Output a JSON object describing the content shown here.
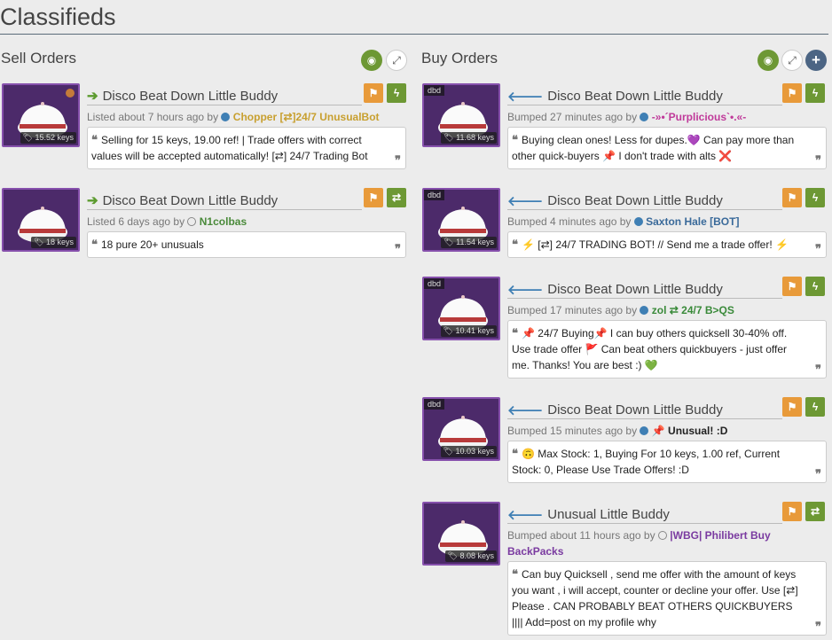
{
  "page_title": "Classifieds",
  "sections": {
    "sell_title": "Sell Orders",
    "buy_title": "Buy Orders"
  },
  "icons": {
    "eye": "◉",
    "expand": "⤢",
    "plus": "+",
    "flag": "⚑",
    "lightning": "ϟ",
    "swap": "⇄",
    "arrow_right": "➔",
    "arrow_left": "🡐",
    "quote_open": "❝",
    "quote_close": "❞",
    "tag": "🏷"
  },
  "sell_listings": [
    {
      "item": "Disco Beat Down Little Buddy",
      "price": "15.52 keys",
      "listed": "Listed about 7 hours ago by",
      "user": "Chopper [⇄]24/7 UnusualBot",
      "user_color": "#c8a030",
      "message": "Selling for 15 keys, 19.00 ref! | Trade offers with correct values will be accepted automatically! [⇄] 24/7 Trading Bot",
      "action": "lightning"
    },
    {
      "item": "Disco Beat Down Little Buddy",
      "price": "18 keys",
      "listed": "Listed 6 days ago by",
      "user": "N1colbas",
      "user_color": "#4a8a3a",
      "message": "18 pure 20+ unusuals",
      "action": "swap"
    }
  ],
  "buy_listings": [
    {
      "item": "Disco Beat Down Little Buddy",
      "price": "11.68 keys",
      "tag": "dbd",
      "listed": "Bumped 27 minutes ago by",
      "user": "-»•´Purplicious`•.«-",
      "user_color": "#c03a9a",
      "message": "Buying clean ones! Less for dupes.💜 Can pay more than other quick-buyers 📌 I don't trade with alts ❌",
      "action": "lightning"
    },
    {
      "item": "Disco Beat Down Little Buddy",
      "price": "11.54 keys",
      "tag": "dbd",
      "listed": "Bumped 4 minutes ago by",
      "user": "Saxton Hale [BOT]",
      "user_color": "#3a6a9a",
      "message": "⚡ [⇄] 24/7 TRADING BOT! // Send me a trade offer! ⚡",
      "action": "lightning"
    },
    {
      "item": "Disco Beat Down Little Buddy",
      "price": "10.41 keys",
      "tag": "dbd",
      "listed": "Bumped 17 minutes ago by",
      "user": "zol ⇄ 24/7 B>QS",
      "user_color": "#3a8a3a",
      "message": "📌 24/7 Buying📌  I can buy others quicksell 30-40% off. Use trade offer 🚩 Can beat others quickbuyers - just offer me. Thanks! You are best :) 💚",
      "action": "lightning"
    },
    {
      "item": "Disco Beat Down Little Buddy",
      "price": "10.03 keys",
      "tag": "dbd",
      "listed": "Bumped 15 minutes ago by",
      "user": "📌 Unusual! :D",
      "user_color": "#222222",
      "message": "🙃 Max Stock: 1, Buying For 10 keys, 1.00 ref, Current Stock: 0, Please Use Trade Offers! :D",
      "action": "lightning"
    },
    {
      "item": "Unusual Little Buddy",
      "price": "8.08 keys",
      "tag": "",
      "listed": "Bumped about 11 hours ago by",
      "user": "|WBG| Philibert Buy BackPacks",
      "user_color": "#7a3aa0",
      "message": "Can buy Quicksell , send me offer with the amount of keys you want , i will accept, counter or decline your offer. Use [⇄] Please . CAN PROBABLY BEAT OTHERS QUICKBUYERS |||| Add=post on my profile why",
      "action": "swap"
    }
  ]
}
